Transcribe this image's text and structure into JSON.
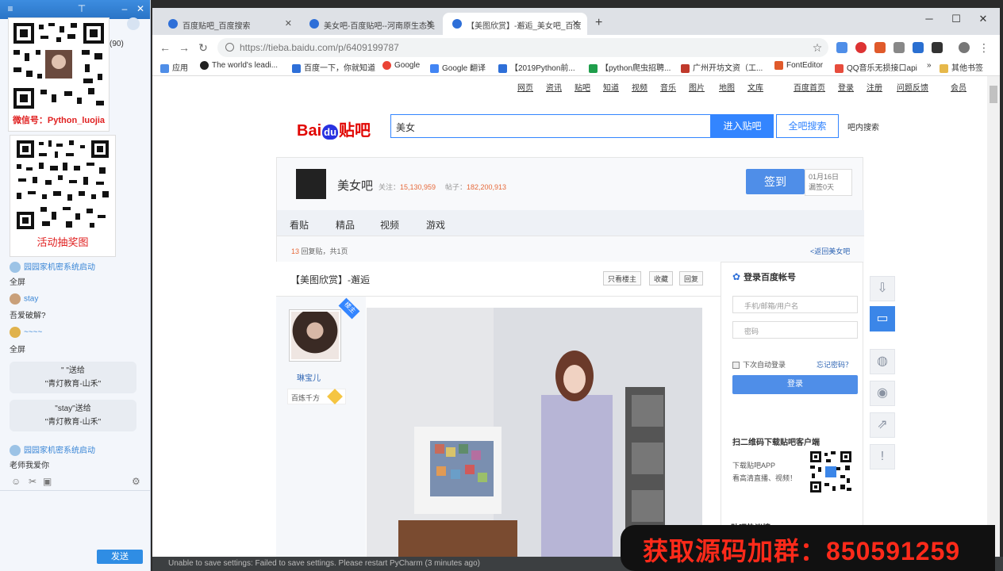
{
  "chat": {
    "header_count": "(90)",
    "qr1_caption": "微信号：Python_luojia",
    "qr2_caption": "活动抽奖图",
    "messages": [
      {
        "sys": "园园家机密系统启动",
        "text": "全屏"
      },
      {
        "user": "stay",
        "text": "吾爱破解?"
      },
      {
        "user": "~~~~",
        "text": "全屏"
      }
    ],
    "gifts": [
      {
        "line1": "\"  \"送给",
        "line2": "\"青灯教育-山禾\""
      },
      {
        "line1": "\"stay\"送给",
        "line2": "\"青灯教育-山禾\""
      }
    ],
    "last_sys": "园园家机密系统启动",
    "last_text": "老师我爱你",
    "send_label": "发送"
  },
  "browser": {
    "tabs": [
      "百度贴吧_百度搜索",
      "美女吧-百度贴吧--河南原生态美",
      "【美图欣赏】-邂逅_美女吧_百度"
    ],
    "url": "https://tieba.baidu.com/p/6409199787",
    "bookmarks": [
      "应用",
      "The world's leadi...",
      "百度一下，你就知道",
      "Google",
      "Google 翻译",
      "【2019Python前...",
      "【python爬虫招聘...",
      "广州开坊文资（工...",
      "FontEditor",
      "QQ音乐无损接口api",
      "»",
      "其他书签"
    ]
  },
  "tieba": {
    "topnav": [
      "网页",
      "资讯",
      "贴吧",
      "知道",
      "视频",
      "音乐",
      "图片",
      "地图",
      "文库",
      "百度首页",
      "登录",
      "注册",
      "问题反馈",
      "会员"
    ],
    "logo_text": "Bai",
    "logo_du": "du",
    "logo_tieba": "贴吧",
    "search_value": "美女",
    "enter_btn": "进入贴吧",
    "all_btn": "全吧搜索",
    "inner_search": "吧内搜索",
    "forum_name": "美女吧",
    "follow_label": "关注：",
    "follow_count": "15,130,959",
    "posts_label": "帖子：",
    "posts_count": "182,200,913",
    "sign_btn": "签到",
    "sign_date": "01月16日",
    "sign_days": "漏签0天",
    "tabs": [
      "看贴",
      "精品",
      "视频",
      "游戏"
    ],
    "reply_num": "13",
    "reply_text": "回复贴，共1页",
    "back_link": "<返回美女吧",
    "post_title": "【美图欣赏】-邂逅",
    "post_buttons": [
      "只看楼主",
      "收藏",
      "回复"
    ],
    "badge": "楼主",
    "author_name": "琳宝儿",
    "author_level": "百炼千方",
    "login_title": "登录百度帐号",
    "login_user_ph": "手机/邮箱/用户名",
    "login_pass_ph": "密码",
    "login_remember": "下次自动登录",
    "login_forgot": "忘记密码？",
    "login_btn": "登录",
    "app_title": "扫二维码下载贴吧客户端",
    "app_desc1": "下载贴吧APP",
    "app_desc2": "看高清直播、视频！",
    "hot_title": "贴吧热议榜"
  },
  "status": {
    "text": "Unable to save settings: Failed to save settings. Please restart PyCharm (3 minutes ago)"
  },
  "promo": {
    "label": "获取源码加群：",
    "number": "850591259"
  }
}
